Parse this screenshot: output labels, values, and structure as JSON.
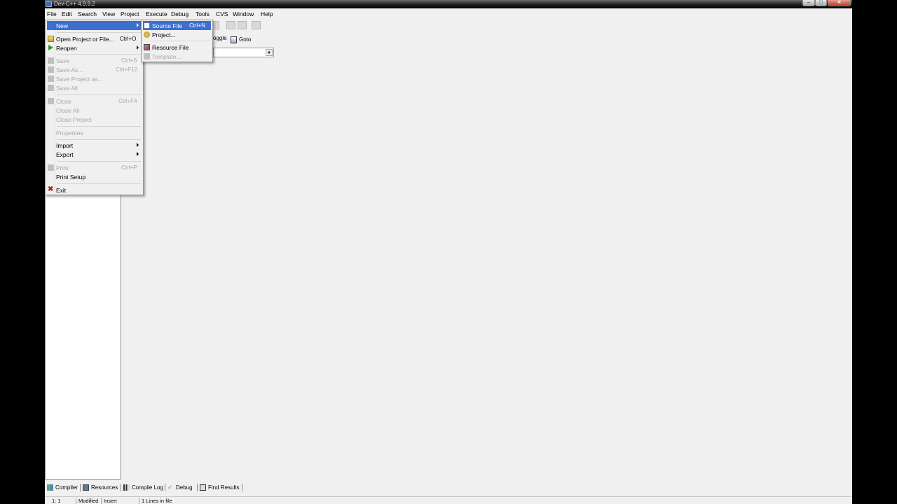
{
  "window": {
    "title": "Dev-C++ 4.9.9.2"
  },
  "menubar": [
    "File",
    "Edit",
    "Search",
    "View",
    "Project",
    "Execute",
    "Debug",
    "Tools",
    "CVS",
    "Window",
    "Help"
  ],
  "toolbar": {
    "toggle_label": "oggle",
    "goto_label": "Goto"
  },
  "file_menu": {
    "new": "New",
    "open": "Open Project or File...",
    "open_short": "Ctrl+O",
    "reopen": "Reopen",
    "save": "Save",
    "save_short": "Ctrl+S",
    "save_as": "Save As...",
    "save_as_short": "Ctrl+F12",
    "save_project_as": "Save Project as...",
    "save_all": "Save All",
    "close": "Close",
    "close_short": "Ctrl+F4",
    "close_all": "Close All",
    "close_project": "Close Project",
    "properties": "Properties",
    "import": "Import",
    "export": "Export",
    "print": "Print",
    "print_short": "Ctrl+P",
    "print_setup": "Print Setup",
    "exit": "Exit"
  },
  "new_submenu": {
    "source_file": "Source File",
    "source_file_short": "Ctrl+N",
    "project": "Project...",
    "resource_file": "Resource File",
    "template": "Template..."
  },
  "bottom_tabs": {
    "compiler": "Compiler",
    "resources": "Resources",
    "compile_log": "Compile Log",
    "debug": "Debug",
    "find_results": "Find Results"
  },
  "status": {
    "position": "1: 1",
    "modified": "Modified",
    "insert": "Insert",
    "lines": "1 Lines in file"
  },
  "colors": {
    "highlight": "#3c6fd0",
    "disabled_text": "#a7a7a7",
    "background": "#f0f0f0"
  }
}
